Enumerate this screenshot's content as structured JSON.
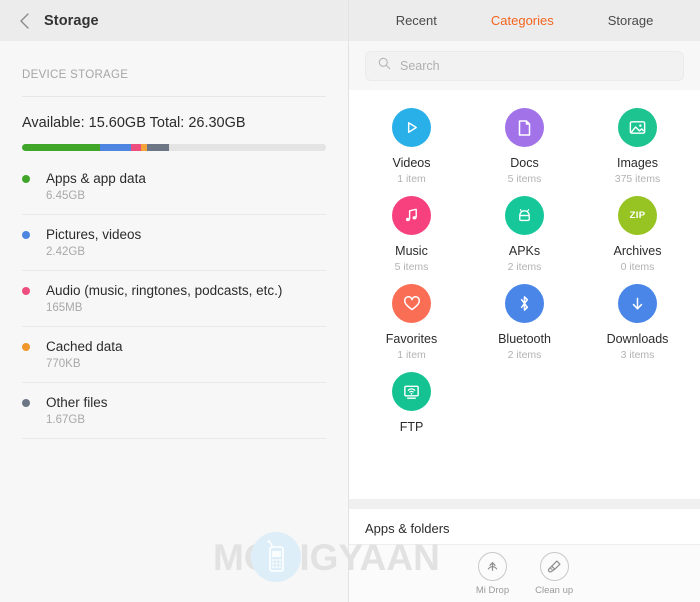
{
  "left": {
    "header": {
      "title": "Storage",
      "back_icon": "chevron-left-icon"
    },
    "section_label": "DEVICE STORAGE",
    "available_total": "Available: 15.60GB  Total: 26.30GB",
    "bar_segments": [
      {
        "name": "apps",
        "color": "#3fa62a",
        "percent": 25.5
      },
      {
        "name": "pictures",
        "color": "#4d85e0",
        "percent": 10.5
      },
      {
        "name": "audio",
        "color": "#ee4e7e",
        "percent": 3.0
      },
      {
        "name": "cached",
        "color": "#f5a43c",
        "percent": 2.0
      },
      {
        "name": "other",
        "color": "#6d7685",
        "percent": 7.5
      },
      {
        "name": "free",
        "color": "#e4e4e4",
        "percent": 51.5
      }
    ],
    "items": [
      {
        "name": "Apps & app data",
        "size": "6.45GB",
        "color": "#3fa62a"
      },
      {
        "name": "Pictures, videos",
        "size": "2.42GB",
        "color": "#4d85e0"
      },
      {
        "name": "Audio (music, ringtones, podcasts, etc.)",
        "size": "165MB",
        "color": "#ee4e7e"
      },
      {
        "name": "Cached data",
        "size": "770KB",
        "color": "#f0962b"
      },
      {
        "name": "Other files",
        "size": "1.67GB",
        "color": "#6d7685"
      }
    ]
  },
  "right": {
    "tabs": [
      {
        "label": "Recent",
        "active": false
      },
      {
        "label": "Categories",
        "active": true
      },
      {
        "label": "Storage",
        "active": false
      }
    ],
    "active_tab_color": "#f4651f",
    "search": {
      "placeholder": "Search",
      "icon": "search-icon",
      "value": ""
    },
    "categories": [
      {
        "label": "Videos",
        "sub": "1 item",
        "color": "#2ab0e8",
        "icon": "play-icon"
      },
      {
        "label": "Docs",
        "sub": "5 items",
        "color": "#a273e8",
        "icon": "document-icon"
      },
      {
        "label": "Images",
        "sub": "375 items",
        "color": "#1ec48f",
        "icon": "picture-icon"
      },
      {
        "label": "Music",
        "sub": "5 items",
        "color": "#f6417e",
        "icon": "music-note-icon"
      },
      {
        "label": "APKs",
        "sub": "2 items",
        "color": "#16c79a",
        "icon": "android-icon"
      },
      {
        "label": "Archives",
        "sub": "0 items",
        "color": "#97c423",
        "icon": "zip-icon",
        "glyph_text": "ZIP"
      },
      {
        "label": "Favorites",
        "sub": "1 item",
        "color": "#fa6e55",
        "icon": "heart-icon"
      },
      {
        "label": "Bluetooth",
        "sub": "2 items",
        "color": "#4a86e8",
        "icon": "bluetooth-icon"
      },
      {
        "label": "Downloads",
        "sub": "3 items",
        "color": "#4a86e8",
        "icon": "download-arrow-icon"
      },
      {
        "label": "FTP",
        "sub": "",
        "color": "#15c392",
        "icon": "ftp-monitor-icon"
      }
    ],
    "apps_folders_label": "Apps & folders",
    "bottom_actions": [
      {
        "label": "Mi Drop",
        "icon": "mi-drop-icon"
      },
      {
        "label": "Clean up",
        "icon": "broom-icon"
      }
    ]
  },
  "watermark": {
    "text": "MOBIGYAAN",
    "logo_icon": "mobile-phone-icon"
  }
}
